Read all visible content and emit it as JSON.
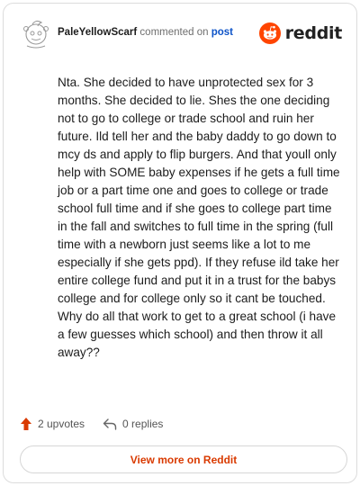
{
  "header": {
    "username": "PaleYellowScarf",
    "action_text": "commented on",
    "link_text": "post",
    "brand": "reddit"
  },
  "comment": {
    "body": "Nta. She decided to have unprotected sex for 3 months. She decided to lie. Shes the one deciding not to go to college or trade school and ruin her future. Ild tell her and the baby daddy to go down to mcy ds and apply to flip burgers. And that youll only help with SOME baby expenses if he gets a full time job or a part time one and goes to college or trade school full time and if she goes to college part time in the fall and switches to full time in the spring (full time with a newborn just seems like a lot to me especially if she gets ppd). If they refuse ild take her entire college fund and put it in a trust for the babys college and for college only so it cant be touched. Why do all that work to get to a great school (i have a few guesses which school) and then throw it all away??"
  },
  "stats": {
    "upvotes": "2 upvotes",
    "replies": "0 replies"
  },
  "cta": {
    "label": "View more on Reddit"
  },
  "colors": {
    "brand_orange": "#ff4500",
    "link_blue": "#0d53c8",
    "upvote_orange": "#d93a00",
    "cta_text": "#d93a00"
  },
  "icons": {
    "avatar": "snoo-avatar-icon",
    "brand": "reddit-logo-icon",
    "upvote": "upvote-arrow-icon",
    "reply": "reply-arrow-icon"
  }
}
